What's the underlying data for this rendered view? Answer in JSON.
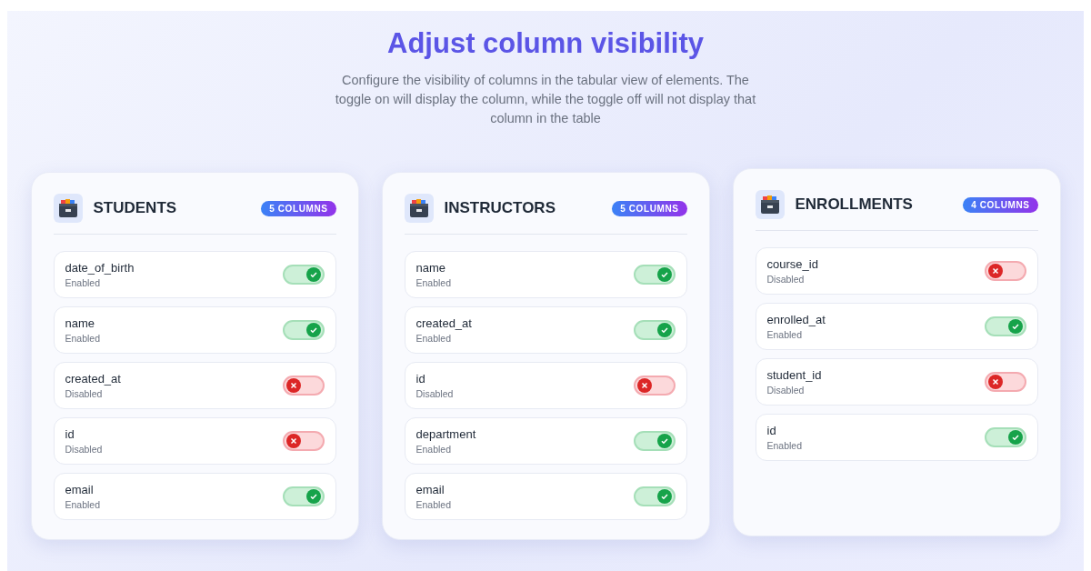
{
  "title": "Adjust column visibility",
  "description": "Configure the visibility of columns in the tabular view of elements. The toggle on will display the column, while the toggle off will not display that column in the table",
  "tables": [
    {
      "name": "STUDENTS",
      "badge": "5 COLUMNS",
      "columns": [
        {
          "name": "date_of_birth",
          "status": "Enabled",
          "on": true
        },
        {
          "name": "name",
          "status": "Enabled",
          "on": true
        },
        {
          "name": "created_at",
          "status": "Disabled",
          "on": false
        },
        {
          "name": "id",
          "status": "Disabled",
          "on": false
        },
        {
          "name": "email",
          "status": "Enabled",
          "on": true
        }
      ]
    },
    {
      "name": "INSTRUCTORS",
      "badge": "5 COLUMNS",
      "columns": [
        {
          "name": "name",
          "status": "Enabled",
          "on": true
        },
        {
          "name": "created_at",
          "status": "Enabled",
          "on": true
        },
        {
          "name": "id",
          "status": "Disabled",
          "on": false
        },
        {
          "name": "department",
          "status": "Enabled",
          "on": true
        },
        {
          "name": "email",
          "status": "Enabled",
          "on": true
        }
      ]
    },
    {
      "name": "ENROLLMENTS",
      "badge": "4 COLUMNS",
      "columns": [
        {
          "name": "course_id",
          "status": "Disabled",
          "on": false
        },
        {
          "name": "enrolled_at",
          "status": "Enabled",
          "on": true
        },
        {
          "name": "student_id",
          "status": "Disabled",
          "on": false
        },
        {
          "name": "id",
          "status": "Enabled",
          "on": true
        }
      ]
    }
  ]
}
